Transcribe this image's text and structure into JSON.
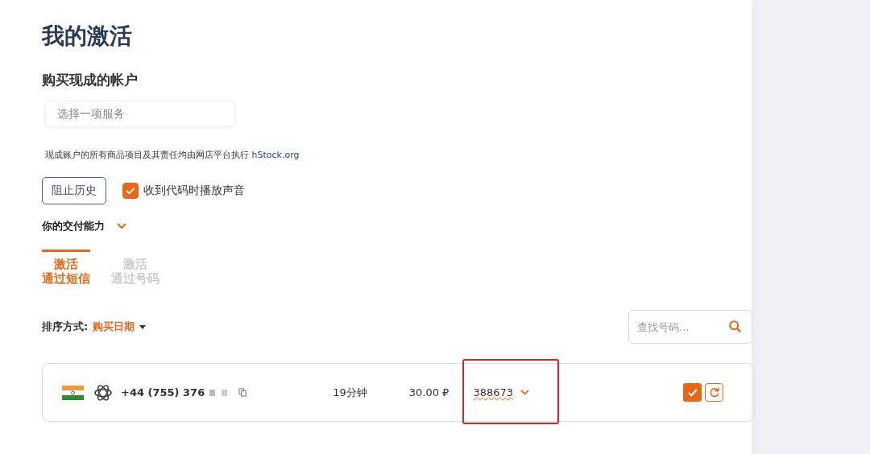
{
  "title": "我的激活",
  "buy_section": {
    "heading": "购买现成的帐户",
    "service_select": {
      "placeholder": "选择一项服务"
    },
    "notice": "现成账户的所有商品项目及其责任均由网店平台执行",
    "notice_link": "hStock.org"
  },
  "block_history_button": "阻止历史",
  "sound_checkbox": {
    "label": "收到代码时播放声音",
    "checked": true
  },
  "delivery": {
    "label": "你的交付能力",
    "expanded": false
  },
  "tabs": [
    {
      "line1": "激活",
      "line2": "通过短信",
      "selected": true
    },
    {
      "line1": "激活",
      "line2": "通过号码",
      "selected": false
    }
  ],
  "sort": {
    "label": "排序方式:",
    "value": "购买日期"
  },
  "search": {
    "placeholder": "查找号码..."
  },
  "activations": [
    {
      "phone": "+44 (755) 376",
      "time": "19分钟",
      "price": "30.00 ₽",
      "code": "388673",
      "highlighted": true
    }
  ]
}
